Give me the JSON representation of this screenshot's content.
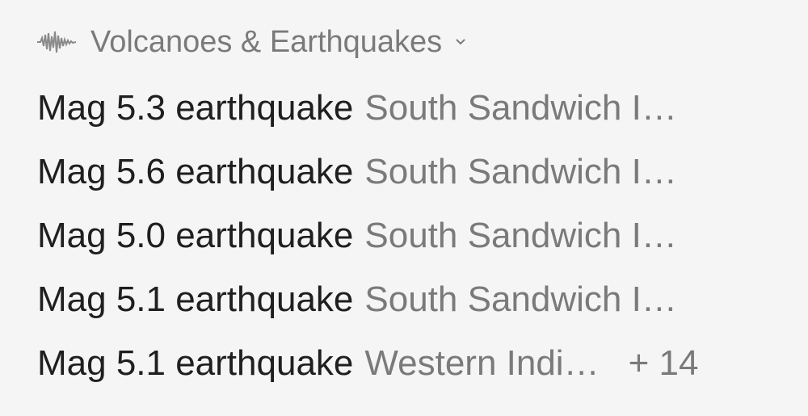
{
  "header": {
    "title": "Volcanoes & Earthquakes",
    "icon": "seismograph-icon",
    "dropdown_icon": "chevron-down-icon"
  },
  "items": [
    {
      "title": "Mag 5.3 earthquake",
      "place": "South Sandwich I…"
    },
    {
      "title": "Mag 5.6 earthquake",
      "place": "South Sandwich I…"
    },
    {
      "title": "Mag 5.0 earthquake",
      "place": "South Sandwich I…"
    },
    {
      "title": "Mag 5.1 earthquake",
      "place": "South Sandwich I…"
    },
    {
      "title": "Mag 5.1 earthquake",
      "place": "Western Indi…"
    }
  ],
  "more_count": "+ 14",
  "colors": {
    "primary_text": "#1f1f1f",
    "secondary_text": "#7a7a7a",
    "background": "#f5f5f5"
  }
}
